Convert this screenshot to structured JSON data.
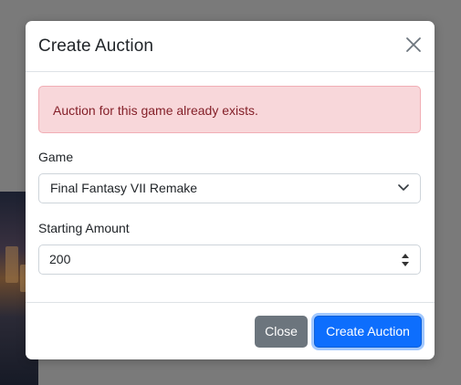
{
  "modal": {
    "title": "Create Auction",
    "close_icon": "close-icon",
    "alert_text": "Auction for this game already exists.",
    "alert_color": "#f8d7da",
    "fields": {
      "game_label": "Game",
      "game_value": "Final Fantasy VII Remake",
      "amount_label": "Starting Amount",
      "amount_value": "200"
    },
    "footer": {
      "close_label": "Close",
      "create_label": "Create Auction"
    }
  },
  "colors": {
    "primary": "#0d6efd",
    "secondary": "#6c757d",
    "danger_text": "#842029"
  }
}
